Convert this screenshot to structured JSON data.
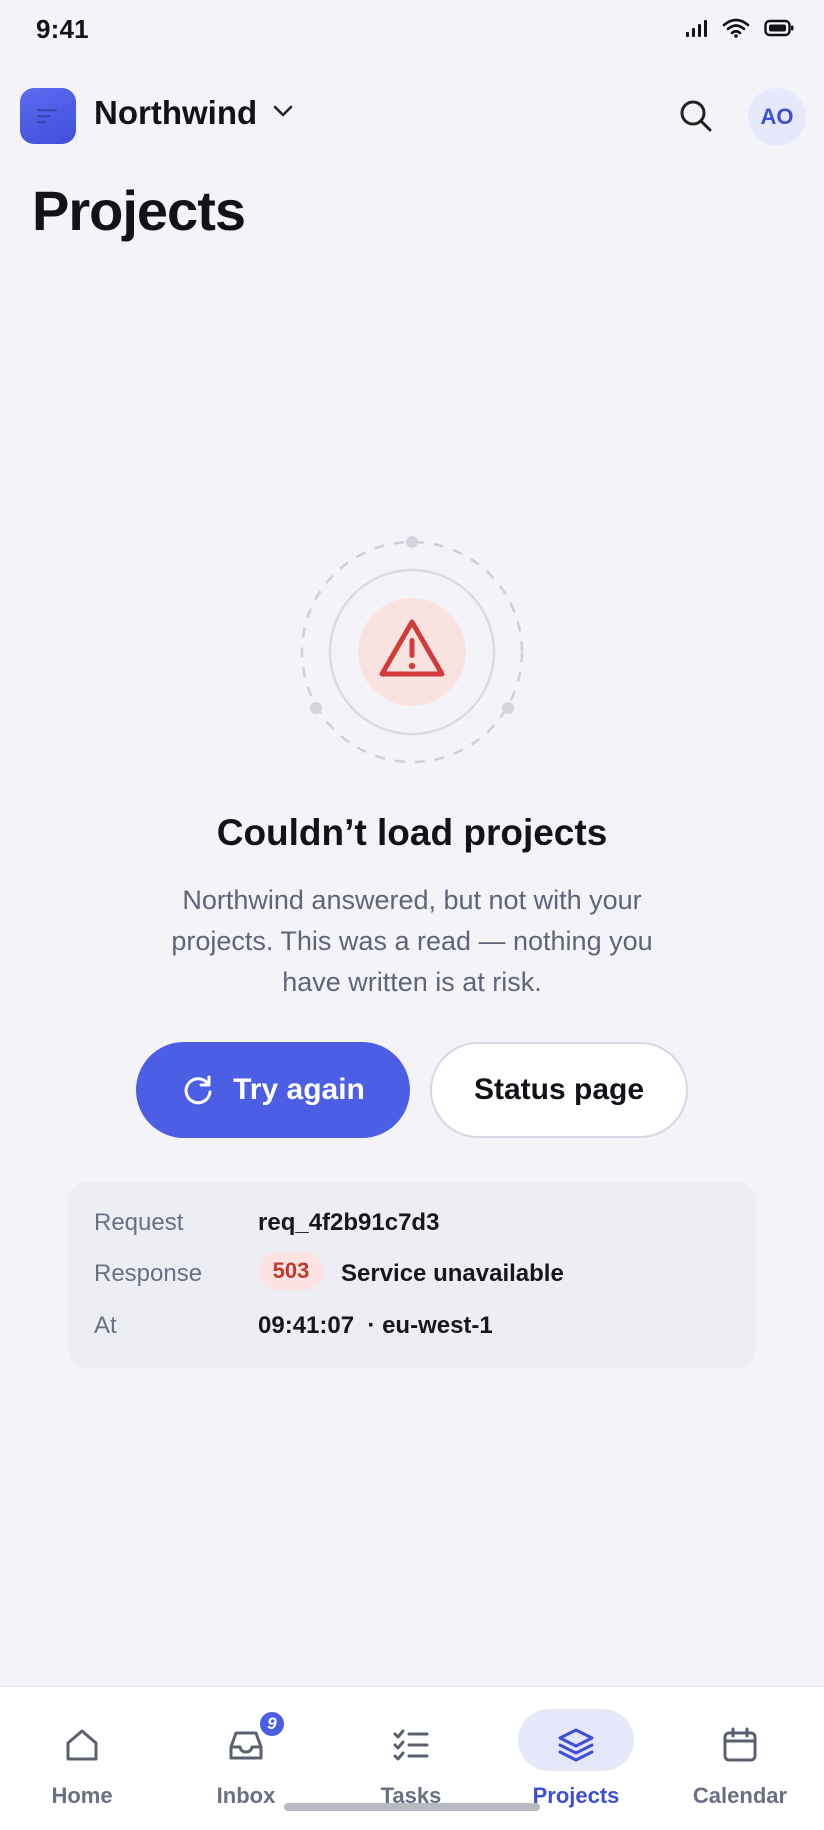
{
  "status_bar": {
    "time": "9:41"
  },
  "header": {
    "workspace_name": "Northwind",
    "avatar_initials": "AO"
  },
  "page": {
    "title": "Projects"
  },
  "error": {
    "title": "Couldn’t load projects",
    "body": "Northwind answered, but not with your projects. This was a read — nothing you have written is at risk.",
    "retry_label": "Try again",
    "status_label": "Status page"
  },
  "details": {
    "request_label": "Request",
    "request_value": "req_4f2b91c7d3",
    "response_label": "Response",
    "response_code": "503",
    "response_value": "Service unavailable",
    "at_label": "At",
    "at_value": "09:41:07  · eu-west-1"
  },
  "nav": {
    "items": [
      {
        "label": "Home",
        "icon": "home-icon"
      },
      {
        "label": "Inbox",
        "icon": "inbox-icon",
        "badge": "9"
      },
      {
        "label": "Tasks",
        "icon": "tasks-icon"
      },
      {
        "label": "Projects",
        "icon": "layers-icon",
        "active": true
      },
      {
        "label": "Calendar",
        "icon": "calendar-icon"
      }
    ]
  },
  "colors": {
    "accent": "#4b5ee4",
    "danger": "#d23b3b",
    "background": "#f4f4f8"
  }
}
